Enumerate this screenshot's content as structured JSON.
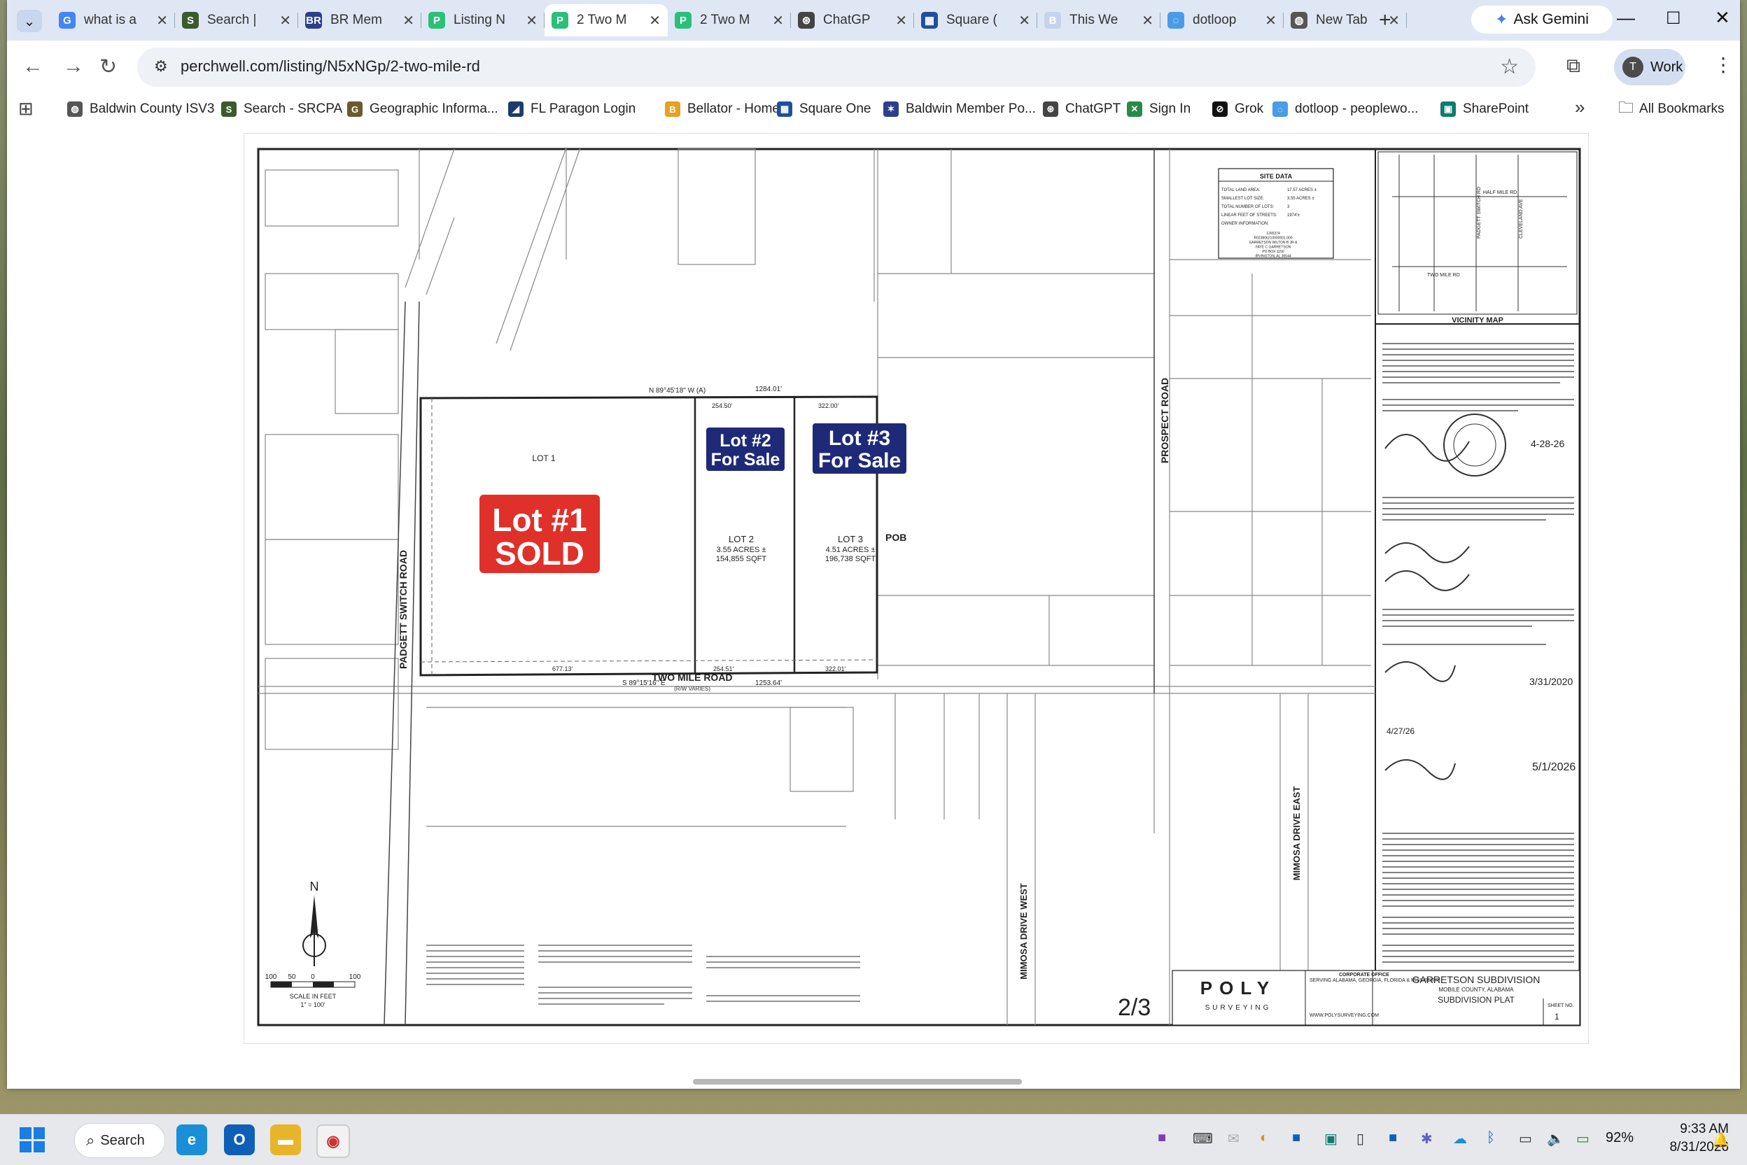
{
  "browser": {
    "tabs": [
      {
        "title": "what is a",
        "icon": "google-icon",
        "color": "#4285f4",
        "glyph": "G"
      },
      {
        "title": "Search |",
        "icon": "srcpa-icon",
        "color": "#3b5a2e",
        "glyph": "S"
      },
      {
        "title": "BR Mem",
        "icon": "baldwin-icon",
        "color": "#2d3e8c",
        "glyph": "BR"
      },
      {
        "title": "Listing N",
        "icon": "perchwell-icon",
        "color": "#2bbf7a",
        "glyph": "P"
      },
      {
        "title": "2 Two M",
        "icon": "perchwell-icon",
        "color": "#2bbf7a",
        "glyph": "P",
        "active": true
      },
      {
        "title": "2 Two M",
        "icon": "perchwell-icon",
        "color": "#2bbf7a",
        "glyph": "P"
      },
      {
        "title": "ChatGP",
        "icon": "chatgpt-icon",
        "color": "#444444",
        "glyph": "⊛"
      },
      {
        "title": "Square (",
        "icon": "square-one-icon",
        "color": "#1f4fa0",
        "glyph": "▦"
      },
      {
        "title": "This We",
        "icon": "document-icon",
        "color": "#c7d3ea",
        "glyph": "B"
      },
      {
        "title": "dotloop",
        "icon": "dotloop-icon",
        "color": "#4a9be8",
        "glyph": "◌"
      },
      {
        "title": "New Tab",
        "icon": "globe-icon",
        "color": "#555555",
        "glyph": "◍"
      }
    ],
    "gemini_label": "Ask Gemini",
    "url": "perchwell.com/listing/N5xNGp/2-two-mile-rd",
    "profile_initial": "T",
    "profile_label": "Work"
  },
  "bookmarks": [
    {
      "label": "Baldwin County ISV3",
      "icon": "globe-icon",
      "color": "#555555",
      "glyph": "◍"
    },
    {
      "label": "Search - SRCPA",
      "icon": "srcpa-icon",
      "color": "#3b5a2e",
      "glyph": "S"
    },
    {
      "label": "Geographic Informa...",
      "icon": "gis-icon",
      "color": "#6a5a2e",
      "glyph": "G"
    },
    {
      "label": "FL Paragon Login",
      "icon": "paragon-icon",
      "color": "#1c3b6e",
      "glyph": "◢"
    },
    {
      "label": "Bellator - Home",
      "icon": "bellator-icon",
      "color": "#e8a020",
      "glyph": "B"
    },
    {
      "label": "Square One",
      "icon": "square-one-icon",
      "color": "#1f4fa0",
      "glyph": "▦"
    },
    {
      "label": "Baldwin Member Po...",
      "icon": "baldwin-icon",
      "color": "#2d3e8c",
      "glyph": "✶"
    },
    {
      "label": "ChatGPT",
      "icon": "chatgpt-icon",
      "color": "#444444",
      "glyph": "⊛"
    },
    {
      "label": "Sign In",
      "icon": "signin-icon",
      "color": "#2a8a4a",
      "glyph": "✕"
    },
    {
      "label": "Grok",
      "icon": "grok-icon",
      "color": "#111111",
      "glyph": "⊘"
    },
    {
      "label": "dotloop - peoplewo...",
      "icon": "dotloop-icon",
      "color": "#4a9be8",
      "glyph": "◌"
    },
    {
      "label": "SharePoint",
      "icon": "sharepoint-icon",
      "color": "#0f7b6c",
      "glyph": "▣"
    }
  ],
  "all_bookmarks_label": "All Bookmarks",
  "plat": {
    "lot1_badge": [
      "Lot #1",
      "SOLD"
    ],
    "lot2_badge": [
      "Lot #2",
      "For Sale"
    ],
    "lot3_badge": [
      "Lot #3",
      "For Sale"
    ],
    "lot1_label": "LOT 1",
    "lot2_label": "LOT 2",
    "lot2_area": [
      "3.55 ACRES ±",
      "154,855 SQFT"
    ],
    "lot3_label": "LOT 3",
    "lot3_area": [
      "4.51 ACRES ±",
      "196,738 SQFT"
    ],
    "road_two_mile": "TWO MILE ROAD",
    "road_two_mile_row": "(R/W VARIES)",
    "road_padgett": "PADGETT SWITCH ROAD",
    "road_prospect": "PROSPECT ROAD",
    "road_mimosa_west": "MIMOSA DRIVE WEST",
    "road_mimosa_east": "MIMOSA DRIVE EAST",
    "pob": "POB",
    "bearing_top": "N 89°45'18\" W (A)",
    "dist_top": "1284.01'",
    "bearing_bottom": "S 89°15'16\" E",
    "dist_bottom": "1253.64'",
    "dist_seg": [
      "254.50'",
      "322.00'",
      "677.13'",
      "254.51'",
      "322.01'"
    ],
    "site_data_title": "SITE DATA",
    "site_data_rows": [
      [
        "TOTAL LAND AREA:",
        "17.57 ACRES ±"
      ],
      [
        "SMALLEST LOT SIZE:",
        "3.55 ACRES ±"
      ],
      [
        "TOTAL NUMBER OF LOTS:",
        "3"
      ],
      [
        "LINEAR FEET OF STREETS:",
        "1974'±"
      ],
      [
        "OWNER INFORMATION:",
        ""
      ]
    ],
    "owner_info": [
      "1265374",
      "R023806210000001.000",
      "GARRETSON WILTON B JR &",
      "FAYE C GARRETSON",
      "PO BOX 1150",
      "IRVINGTON, AL 36544"
    ],
    "vicinity_map_label": "VICINITY MAP",
    "vicinity_roads": [
      "TWO MILE RD",
      "PADGETT SWITCH RD",
      "HALF MILE RD",
      "CLEVELAND AVE"
    ],
    "surveyor_date": "4-28-26",
    "notary_date": "3/31/2020",
    "approval_date": "4/27/26",
    "engineer_date": "5/1/2026",
    "title_block": {
      "company": "POLY",
      "company_sub": "SURVEYING",
      "states": "SERVING ALABAMA, GEORGIA, FLORIDA & MISSISSIPPI",
      "website": "WWW.POLYSURVEYING.COM",
      "office": "CORPORATE OFFICE",
      "subdivision": "GARRETSON SUBDIVISION",
      "county": "MOBILE COUNTY, ALABAMA",
      "plat_type": "SUBDIVISION PLAT",
      "sheet_label": "SHEET NO.",
      "sheet": "1"
    },
    "scale_label": [
      "SCALE IN FEET",
      "1\" = 100'"
    ],
    "scale_ticks": [
      "100",
      "50",
      "0",
      "100"
    ],
    "north": "N",
    "page_indicator": "2/3"
  },
  "taskbar": {
    "search_label": "Search",
    "battery": "92%",
    "time": "9:33 AM",
    "date": "8/31/2026"
  }
}
